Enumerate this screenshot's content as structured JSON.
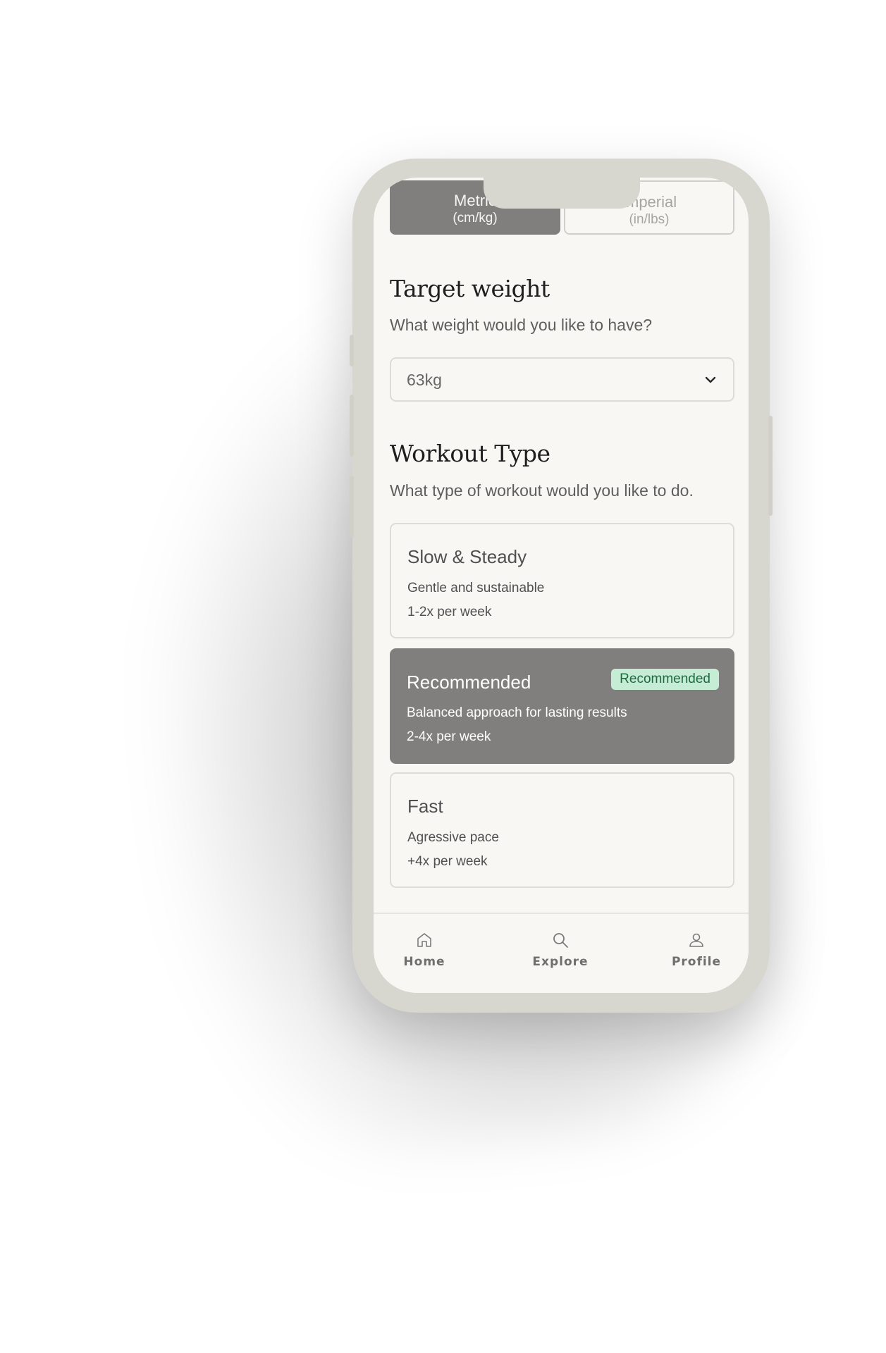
{
  "units": {
    "metric_label": "Metric",
    "metric_sub": "(cm/kg)",
    "imperial_label": "Imperial",
    "imperial_sub": "(in/lbs)",
    "selected": "metric"
  },
  "target_weight": {
    "heading": "Target weight",
    "question": "What weight would you like to have?",
    "selected_value": "63kg"
  },
  "workout_type": {
    "heading": "Workout Type",
    "question": "What type of workout would you like to do.",
    "options": [
      {
        "title": "Slow & Steady",
        "description": "Gentle and sustainable",
        "frequency": "1-2x per week"
      },
      {
        "title": "Recommended",
        "description": "Balanced approach for lasting results",
        "frequency": "2-4x per week",
        "badge": "Recommended",
        "selected": true
      },
      {
        "title": "Fast",
        "description": "Agressive pace",
        "frequency": "+4x per week"
      }
    ]
  },
  "bottom_nav": {
    "items": [
      {
        "label": "Home",
        "icon": "home-icon"
      },
      {
        "label": "Explore",
        "icon": "search-icon"
      },
      {
        "label": "Profile",
        "icon": "user-icon"
      }
    ]
  },
  "colors": {
    "phone_frame": "#d7d7cf",
    "screen_bg": "#f8f7f4",
    "selected_card": "#807f7d",
    "badge_bg": "#c6ecd6",
    "badge_text": "#1e6a40"
  }
}
